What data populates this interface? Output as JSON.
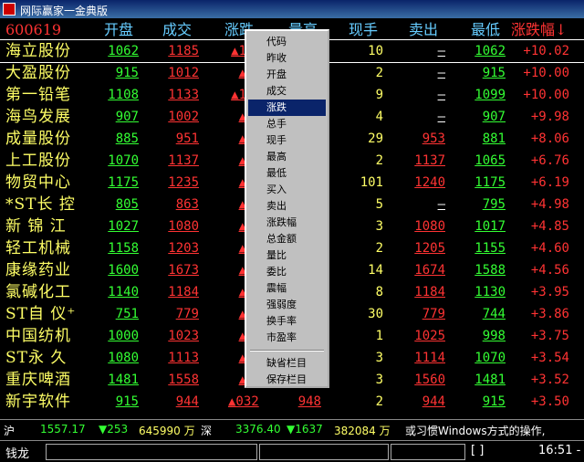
{
  "window": {
    "title": "网际赢家一金典版"
  },
  "header": {
    "code": "600619",
    "cols": [
      "开盘",
      "成交",
      "涨跌",
      "量高",
      "现手",
      "卖出",
      "最低",
      "涨跌幅↓"
    ]
  },
  "colors": {
    "up": "#ff3333",
    "down": "#33ff33",
    "flat": "#ffffff",
    "name": "#ffff66",
    "header": "#66ccff"
  },
  "rows": [
    {
      "name": "海立股份",
      "open": "1062",
      "close": "1185",
      "chg": "▲1",
      "amt": "",
      "hand": "10",
      "sell": "—",
      "low": "1062",
      "pct": "+10.02"
    },
    {
      "name": "大盈股份",
      "open": "915",
      "close": "1012",
      "chg": "▲",
      "amt": "",
      "hand": "2",
      "sell": "—",
      "low": "915",
      "pct": "+10.00"
    },
    {
      "name": "第一铅笔",
      "open": "1108",
      "close": "1133",
      "chg": "▲1",
      "amt": "",
      "hand": "9",
      "sell": "—",
      "low": "1099",
      "pct": "+10.00"
    },
    {
      "name": "海鸟发展",
      "open": "907",
      "close": "1002",
      "chg": "▲",
      "amt": "",
      "hand": "4",
      "sell": "—",
      "low": "907",
      "pct": "+9.98"
    },
    {
      "name": "成量股份",
      "open": "885",
      "close": "951",
      "chg": "▲",
      "amt": "",
      "hand": "29",
      "sell": "953",
      "low": "881",
      "pct": "+8.06"
    },
    {
      "name": "上工股份",
      "open": "1070",
      "close": "1137",
      "chg": "▲",
      "amt": "",
      "hand": "2",
      "sell": "1137",
      "low": "1065",
      "pct": "+6.76"
    },
    {
      "name": "物贸中心",
      "open": "1175",
      "close": "1235",
      "chg": "▲",
      "amt": "",
      "hand": "101",
      "sell": "1240",
      "low": "1175",
      "pct": "+6.19"
    },
    {
      "name": "*ST长 控",
      "open": "805",
      "close": "863",
      "chg": "▲",
      "amt": "",
      "hand": "5",
      "sell": "—",
      "low": "795",
      "pct": "+4.98"
    },
    {
      "name": "新 锦 江",
      "open": "1027",
      "close": "1080",
      "chg": "▲",
      "amt": "",
      "hand": "3",
      "sell": "1080",
      "low": "1017",
      "pct": "+4.85"
    },
    {
      "name": "轻工机械",
      "open": "1158",
      "close": "1203",
      "chg": "▲",
      "amt": "",
      "hand": "2",
      "sell": "1205",
      "low": "1155",
      "pct": "+4.60"
    },
    {
      "name": "康缘药业",
      "open": "1600",
      "close": "1673",
      "chg": "▲",
      "amt": "",
      "hand": "14",
      "sell": "1674",
      "low": "1588",
      "pct": "+4.56"
    },
    {
      "name": "氯碱化工",
      "open": "1140",
      "close": "1184",
      "chg": "▲",
      "amt": "",
      "hand": "8",
      "sell": "1184",
      "low": "1130",
      "pct": "+3.95"
    },
    {
      "name": "ST自 仪⁺",
      "open": "751",
      "close": "779",
      "chg": "▲",
      "amt": "",
      "hand": "30",
      "sell": "779",
      "low": "744",
      "pct": "+3.86"
    },
    {
      "name": "中国纺机",
      "open": "1000",
      "close": "1023",
      "chg": "▲",
      "amt": "",
      "hand": "1",
      "sell": "1025",
      "low": "998",
      "pct": "+3.75"
    },
    {
      "name": "ST永 久",
      "open": "1080",
      "close": "1113",
      "chg": "▲",
      "amt": "",
      "hand": "3",
      "sell": "1114",
      "low": "1070",
      "pct": "+3.54"
    },
    {
      "name": "重庆啤酒",
      "open": "1481",
      "close": "1558",
      "chg": "▲",
      "amt": "",
      "hand": "3",
      "sell": "1560",
      "low": "1481",
      "pct": "+3.52"
    },
    {
      "name": "新宇软件",
      "open": "915",
      "close": "944",
      "chg": "▲032",
      "amt": "948",
      "hand": "2",
      "sell": "944",
      "low": "915",
      "pct": "+3.50"
    }
  ],
  "menu": {
    "items": [
      "代码",
      "昨收",
      "开盘",
      "成交",
      "涨跌",
      "总手",
      "现手",
      "最高",
      "最低",
      "买入",
      "卖出",
      "涨跌幅",
      "总金额",
      "量比",
      "委比",
      "震幅",
      "强弱度",
      "换手率",
      "市盈率"
    ],
    "extra": [
      "缺省栏目",
      "保存栏目"
    ],
    "active": "涨跌"
  },
  "ticker": {
    "sh_label": "沪",
    "sh_index": "1557.17",
    "sh_chg": "▼253",
    "sh_amt": "645990 万",
    "sz_label": "深",
    "sz_index": "3376.40",
    "sz_chg": "▼1637",
    "sz_amt": "382084 万",
    "message": "或习惯Windows方式的操作,"
  },
  "status": {
    "label": "钱龙",
    "bracket": "[          ]",
    "time": "16:51 -"
  }
}
